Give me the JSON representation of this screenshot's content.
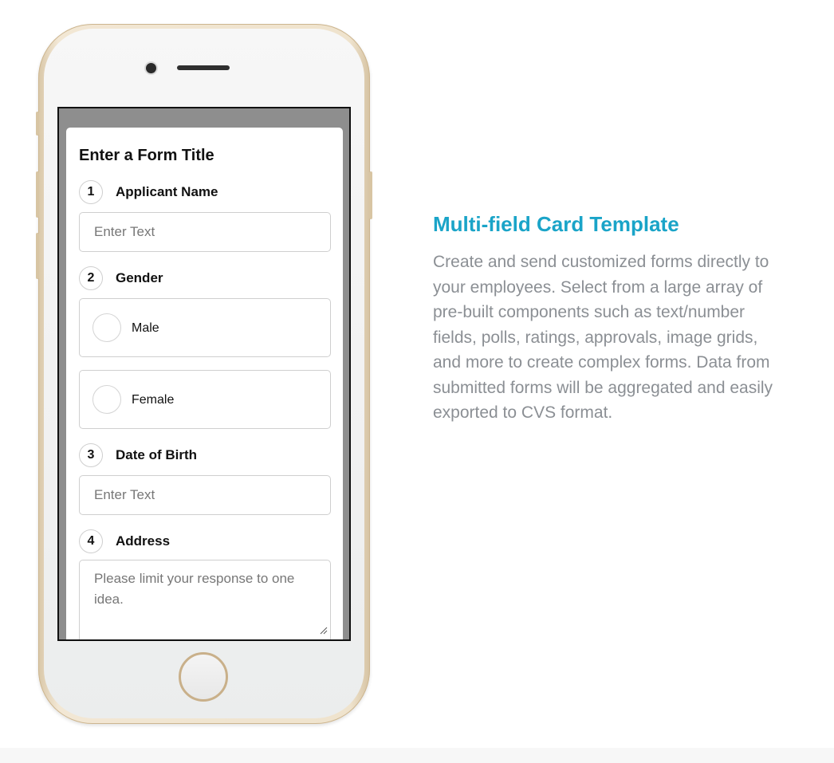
{
  "form": {
    "title": "Enter a Form Title",
    "questions": [
      {
        "number": "1",
        "label": "Applicant Name",
        "placeholder": "Enter Text"
      },
      {
        "number": "2",
        "label": "Gender",
        "options": [
          "Male",
          "Female"
        ]
      },
      {
        "number": "3",
        "label": "Date of Birth",
        "placeholder": "Enter Text"
      },
      {
        "number": "4",
        "label": "Address",
        "placeholder": "Please limit your response to one idea."
      }
    ]
  },
  "feature": {
    "heading": "Multi-field Card Template",
    "description": "Create and send customized forms directly to your employees. Select from a large array of pre-built components such as text/number fields, polls, ratings, approvals, image grids, and more to create complex forms. Data from submitted forms will be aggregated and easily exported to CVS format."
  },
  "colors": {
    "accent": "#1aa4c8",
    "body_text": "#8b8f94",
    "phone_frame": "#efe3cd"
  }
}
